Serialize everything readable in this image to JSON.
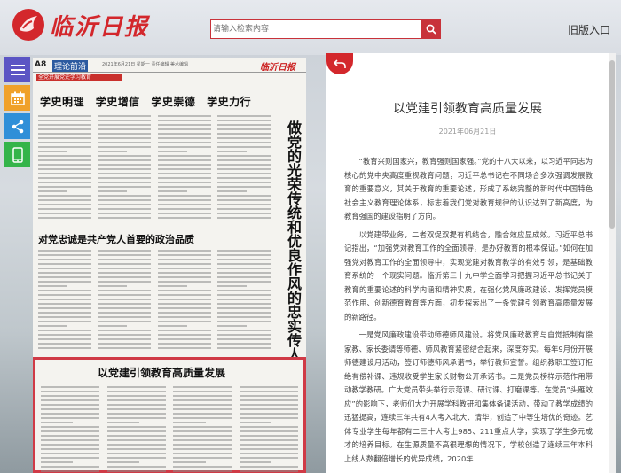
{
  "header": {
    "logo_text": "临沂日报",
    "search_placeholder": "请输入检索内容",
    "old_entry": "旧版入口"
  },
  "tools": [
    "menu-icon",
    "calendar-icon",
    "share-icon",
    "mobile-icon"
  ],
  "paper": {
    "page_no": "A8",
    "section": "理论前沿",
    "info": "2021年6月21日 星期一 责任编辑 美术编辑",
    "logo": "临沂日报",
    "banner": "全党开展党史学习教育",
    "pillars": [
      "学史明理",
      "学史增信",
      "学史崇德",
      "学史力行"
    ],
    "vertical_title": "做党的光荣传统和优良作风的忠实传人",
    "sub_title": "对党忠诚是共产党人首要的政治品质",
    "highlight_title": "以党建引领教育高质量发展"
  },
  "article": {
    "title": "以党建引领教育高质量发展",
    "date": "2021年06月21日",
    "paragraphs": [
      "“教育兴则国家兴，教育强则国家强。”党的十八大以来，以习近平同志为核心的党中央高度重视教育问题，习近平总书记在不同场合多次强调发展教育的重要意义，其关于教育的重要论述，形成了系统完整的新时代中国特色社会主义教育理论体系，标志着我们党对教育规律的认识达到了新高度，为教育强国的建设指明了方向。",
      "以党建带业务，二者双促双提有机结合，融合效应显成效。习近平总书记指出，“加强党对教育工作的全面领导，是办好教育的根本保证。”如何在加强党对教育工作的全面领导中，实现党建对教育教学的有效引领，是基础教育系统的一个现实问题。临沂第三十九中学全面学习把握习近平总书记关于教育的重要论述的科学内涵和精神实质，在强化党风廉政建设、发挥党员模范作用、创新德育教育等方面，初步探索出了一条党建引领教育高质量发展的新路径。",
      "一是党风廉政建设带动师德师风建设。将党风廉政教育与自觉抵制有偿家教、家长委请等师德、师风教育紧密结合起来，深度夯实。每年9月份开展师德建设月活动，签订师德师风承诺书，举行教师宣誓。组织教职工签订拒绝有偿补课、违规收受学生家长财物公开承诺书。二是党员榜样示范作用带动教学教研。广大党员带头举行示范课、研讨课、打磨课等。在党员“头雁效应”的影响下，老师们大力开展学科教研和集体备课活动，带动了教学成绩的迅猛提高，连续三年共有4人考入北大、清华，创造了中等生培优的奇迹。艺体专业学生每年都有二三十人考上985、211重点大学，实现了学生多元成才的培养目标。在生源质量不高很理想的情况下，学校创造了连续三年本科上线人数翻倍增长的优异成绩，2020年"
    ]
  },
  "colors": {
    "brand_red": "#d3272c",
    "menu_purple": "#5b55c4",
    "calendar_orange": "#f0a12a",
    "share_blue": "#2f8fd8",
    "phone_green": "#34b44a"
  }
}
